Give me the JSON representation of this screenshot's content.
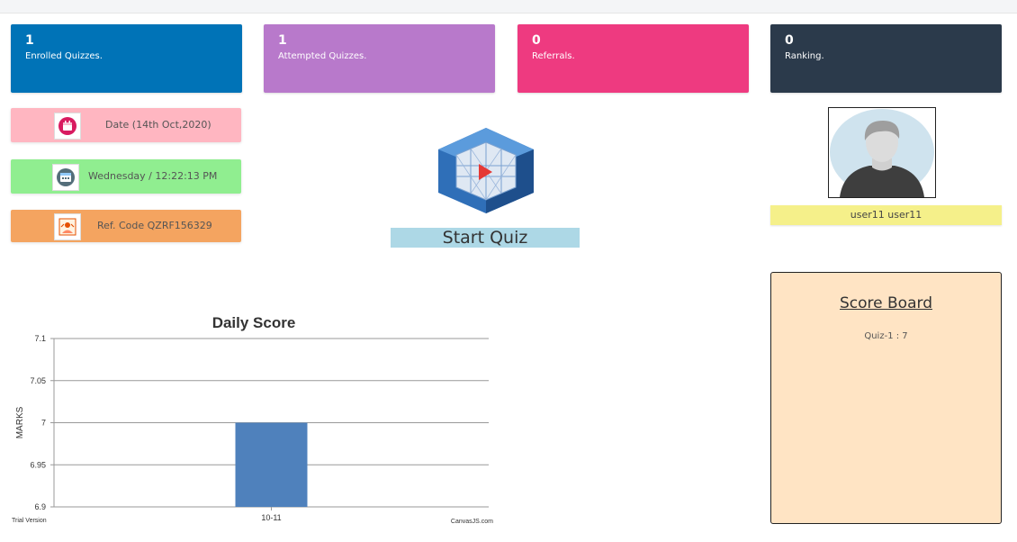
{
  "stats": [
    {
      "value": "1",
      "label": "Enrolled Quizzes.",
      "color": "#0073b7"
    },
    {
      "value": "1",
      "label": "Attempted Quizzes.",
      "color": "#b879cb"
    },
    {
      "value": "0",
      "label": "Referrals.",
      "color": "#ee3a80"
    },
    {
      "value": "0",
      "label": "Ranking.",
      "color": "#2b3a4b"
    }
  ],
  "info": {
    "date": {
      "text": "Date (14th Oct,2020)",
      "icon": "calendar-icon",
      "color": "#ffb6c1"
    },
    "day": {
      "text": "Wednesday / 12:22:13 PM",
      "icon": "schedule-icon",
      "color": "#90ee90"
    },
    "ref": {
      "text": "Ref. Code QZRF156329",
      "icon": "referral-icon",
      "color": "#f4a460"
    }
  },
  "start_quiz": {
    "label": "Start Quiz",
    "icon": "quiz-cube-icon"
  },
  "user": {
    "name": "user11 user11",
    "icon": "avatar-icon"
  },
  "score_board": {
    "title": "Score Board",
    "entries": [
      "Quiz-1 : 7"
    ]
  },
  "chart_data": {
    "type": "bar",
    "title": "Daily Score",
    "categories": [
      "10-11"
    ],
    "values": [
      7
    ],
    "ylabel": "MARKS",
    "xlabel": "",
    "ylim": [
      6.9,
      7.1
    ],
    "yticks": [
      "6.9",
      "6.95",
      "7",
      "7.05",
      "7.1"
    ],
    "grid": true,
    "bar_color": "#4f81bc",
    "footer_left": "Trial Version",
    "footer_right": "CanvasJS.com"
  }
}
